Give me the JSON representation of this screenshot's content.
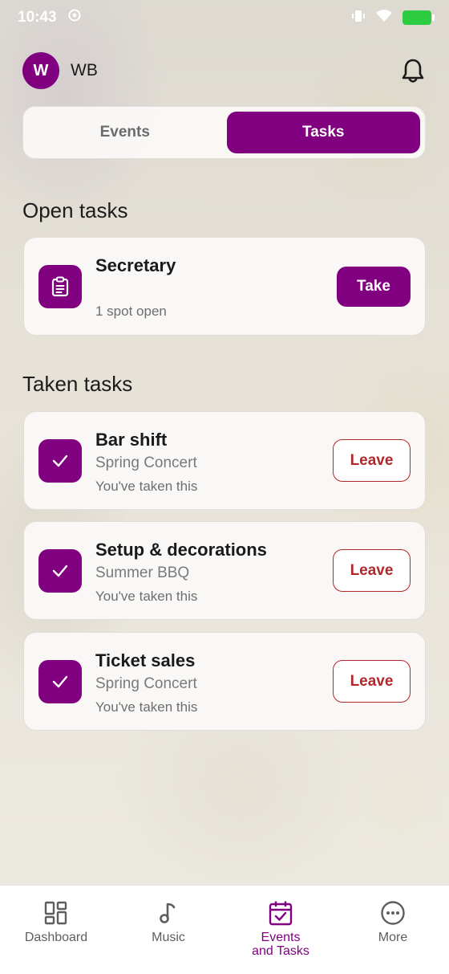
{
  "status_bar": {
    "time": "10:43"
  },
  "header": {
    "avatar_letter": "W",
    "user_name": "WB"
  },
  "segmented": {
    "tabs": [
      {
        "label": "Events",
        "active": false
      },
      {
        "label": "Tasks",
        "active": true
      }
    ]
  },
  "open_tasks": {
    "title": "Open tasks",
    "items": [
      {
        "title": "Secretary",
        "meta": "1 spot open",
        "action": "Take",
        "icon": "clipboard-icon"
      }
    ]
  },
  "taken_tasks": {
    "title": "Taken tasks",
    "items": [
      {
        "title": "Bar shift",
        "event": "Spring Concert",
        "meta": "You've taken this",
        "action": "Leave",
        "icon": "check-icon"
      },
      {
        "title": "Setup & decorations",
        "event": "Summer BBQ",
        "meta": "You've taken this",
        "action": "Leave",
        "icon": "check-icon"
      },
      {
        "title": "Ticket sales",
        "event": "Spring Concert",
        "meta": "You've taken this",
        "action": "Leave",
        "icon": "check-icon"
      }
    ]
  },
  "tabbar": {
    "items": [
      {
        "label": "Dashboard",
        "icon": "dashboard-icon",
        "active": false
      },
      {
        "label": "Music",
        "icon": "music-note-icon",
        "active": false
      },
      {
        "label": "Events\nand Tasks",
        "icon": "calendar-check-icon",
        "active": true
      },
      {
        "label": "More",
        "icon": "more-icon",
        "active": false
      }
    ]
  },
  "colors": {
    "accent": "#800080",
    "danger": "#b3262b",
    "battery": "#2ecc40"
  }
}
